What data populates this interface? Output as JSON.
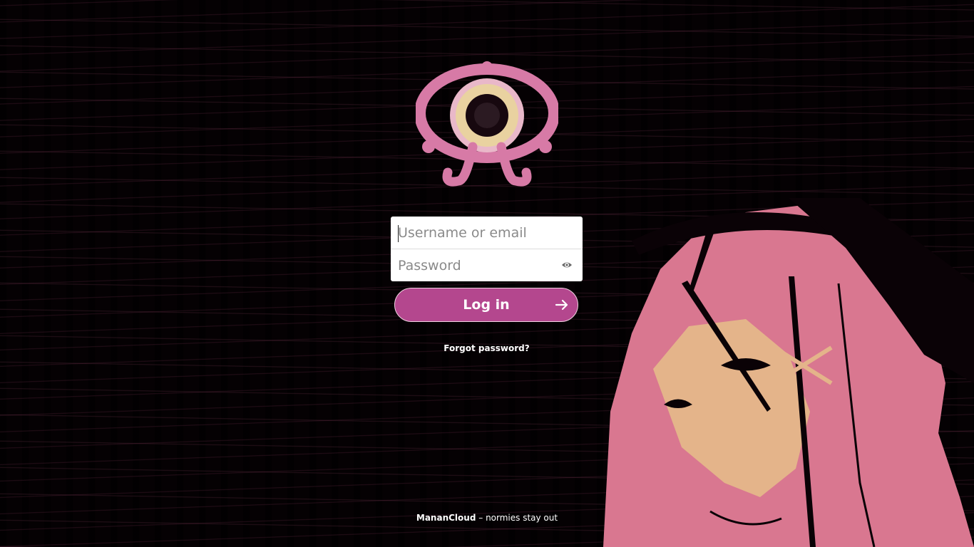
{
  "login": {
    "username_placeholder": "Username or email",
    "password_placeholder": "Password",
    "submit_label": "Log in",
    "forgot_password": "Forgot password?"
  },
  "footer": {
    "brand": "MananCloud",
    "separator": " – ",
    "tagline": "normies stay out"
  },
  "icons": {
    "password_toggle": "eye-icon",
    "submit": "arrow-right-icon",
    "logo": "nextcloud-style-ornament-logo"
  },
  "colors": {
    "accent": "#b4478e",
    "logo_pink": "#d77aa6",
    "logo_cream": "#e9d2a0",
    "background": "#050103",
    "art_pink": "#e0798f"
  }
}
